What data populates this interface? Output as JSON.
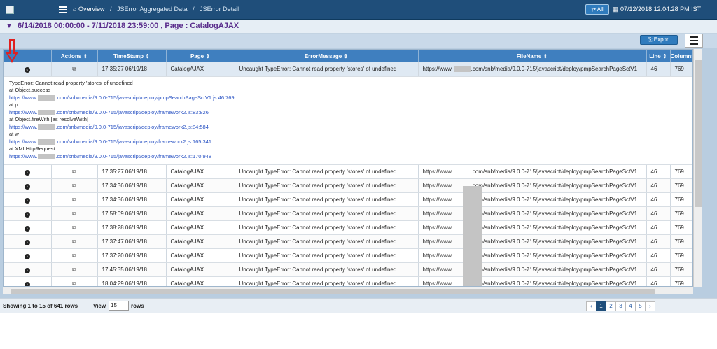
{
  "header": {
    "breadcrumb": [
      "Overview",
      "JSError Aggregated Data",
      "JSError Detail"
    ],
    "all_button": "All",
    "datetime": "07/12/2018 12:04:28 PM IST"
  },
  "filter": {
    "text": "6/14/2018 00:00:00 - 7/11/2018 23:59:00 , Page : CatalogAJAX"
  },
  "toolbar": {
    "export_label": "Export"
  },
  "columns": [
    "",
    "Actions",
    "TimeStamp",
    "Page",
    "ErrorMessage",
    "FileName",
    "Line",
    "Columns"
  ],
  "expanded_row": {
    "timestamp": "17:35:27 06/19/18",
    "page": "CatalogAJAX",
    "message": "Uncaught TypeError: Cannot read property 'stores' of undefined",
    "file": "https://www.",
    "file_rest": ".com/snb/media/9.0.0-715/javascript/deploy/pmpSearchPageSctV1",
    "line": "46",
    "columns": "769"
  },
  "stack_trace": {
    "line0": "TypeError: Cannot read property 'stores' of undefined",
    "line1": "at Object.success",
    "link1a": "https://www.",
    "link1b": ".com/snb/media/9.0.0-715/javascript/deploy/pmpSearchPageSctV1.js:46:769",
    "line2": "at p",
    "link2a": "https://www.",
    "link2b": ".com/snb/media/9.0.0-715/javascript/deploy/framework2.js:83:826",
    "line3": "at Object.fireWith [as resolveWith]",
    "link3a": "https://www.",
    "link3b": ".com/snb/media/9.0.0-715/javascript/deploy/framework2.js:84:584",
    "line4": "at w",
    "link4a": "https://www.",
    "link4b": ".com/snb/media/9.0.0-715/javascript/deploy/framework2.js:165:341",
    "line5": "at XMLHttpRequest.r",
    "link5a": "https://www.",
    "link5b": ".com/snb/media/9.0.0-715/javascript/deploy/framework2.js:170:948"
  },
  "rows": [
    {
      "timestamp": "17:35:27 06/19/18",
      "page": "CatalogAJAX",
      "message": "Uncaught TypeError: Cannot read property 'stores' of undefined",
      "file": "https://www.",
      "file_rest": ".com/snb/media/9.0.0-715/javascript/deploy/pmpSearchPageSctV1",
      "line": "46",
      "columns": "769"
    },
    {
      "timestamp": "17:34:36 06/19/18",
      "page": "CatalogAJAX",
      "message": "Uncaught TypeError: Cannot read property 'stores' of undefined",
      "file": "https://www.",
      "file_rest": ".com/snb/media/9.0.0-715/javascript/deploy/pmpSearchPageSctV1",
      "line": "46",
      "columns": "769"
    },
    {
      "timestamp": "17:34:36 06/19/18",
      "page": "CatalogAJAX",
      "message": "Uncaught TypeError: Cannot read property 'stores' of undefined",
      "file": "https://www.",
      "file_rest": ".com/snb/media/9.0.0-715/javascript/deploy/pmpSearchPageSctV1",
      "line": "46",
      "columns": "769"
    },
    {
      "timestamp": "17:58:09 06/19/18",
      "page": "CatalogAJAX",
      "message": "Uncaught TypeError: Cannot read property 'stores' of undefined",
      "file": "https://www.",
      "file_rest": ".com/snb/media/9.0.0-715/javascript/deploy/pmpSearchPageSctV1",
      "line": "46",
      "columns": "769"
    },
    {
      "timestamp": "17:38:28 06/19/18",
      "page": "CatalogAJAX",
      "message": "Uncaught TypeError: Cannot read property 'stores' of undefined",
      "file": "https://www.",
      "file_rest": ".com/snb/media/9.0.0-715/javascript/deploy/pmpSearchPageSctV1",
      "line": "46",
      "columns": "769"
    },
    {
      "timestamp": "17:37:47 06/19/18",
      "page": "CatalogAJAX",
      "message": "Uncaught TypeError: Cannot read property 'stores' of undefined",
      "file": "https://www.",
      "file_rest": ".com/snb/media/9.0.0-715/javascript/deploy/pmpSearchPageSctV1",
      "line": "46",
      "columns": "769"
    },
    {
      "timestamp": "17:37:20 06/19/18",
      "page": "CatalogAJAX",
      "message": "Uncaught TypeError: Cannot read property 'stores' of undefined",
      "file": "https://www.",
      "file_rest": ".com/snb/media/9.0.0-715/javascript/deploy/pmpSearchPageSctV1",
      "line": "46",
      "columns": "769"
    },
    {
      "timestamp": "17:45:35 06/19/18",
      "page": "CatalogAJAX",
      "message": "Uncaught TypeError: Cannot read property 'stores' of undefined",
      "file": "https://www.",
      "file_rest": ".com/snb/media/9.0.0-715/javascript/deploy/pmpSearchPageSctV1",
      "line": "46",
      "columns": "769"
    },
    {
      "timestamp": "18:04:29 06/19/18",
      "page": "CatalogAJAX",
      "message": "Uncaught TypeError: Cannot read property 'stores' of undefined",
      "file": "https://www.",
      "file_rest": ".com/snb/media/9.0.0-715/javascript/deploy/pmpSearchPageSctV1",
      "line": "46",
      "columns": "769"
    }
  ],
  "footer": {
    "showing": "Showing 1 to 15 of 641 rows",
    "view_label": "View",
    "view_value": "15",
    "rows_label": "rows",
    "pages": [
      "‹",
      "1",
      "2",
      "3",
      "4",
      "5",
      "›"
    ],
    "active_page": "1"
  },
  "colors": {
    "header_bg": "#1f4e7a",
    "table_header": "#3f7fbf",
    "filter_text": "#5a2d8c",
    "annotation_arrow": "#e02020"
  },
  "icons": [
    "image-placeholder-icon",
    "hamburger-icon",
    "home-icon",
    "swap-icon",
    "calendar-icon",
    "filter-icon",
    "export-icon",
    "column-menu-icon",
    "expand-icon",
    "copy-icon",
    "sort-icon"
  ]
}
